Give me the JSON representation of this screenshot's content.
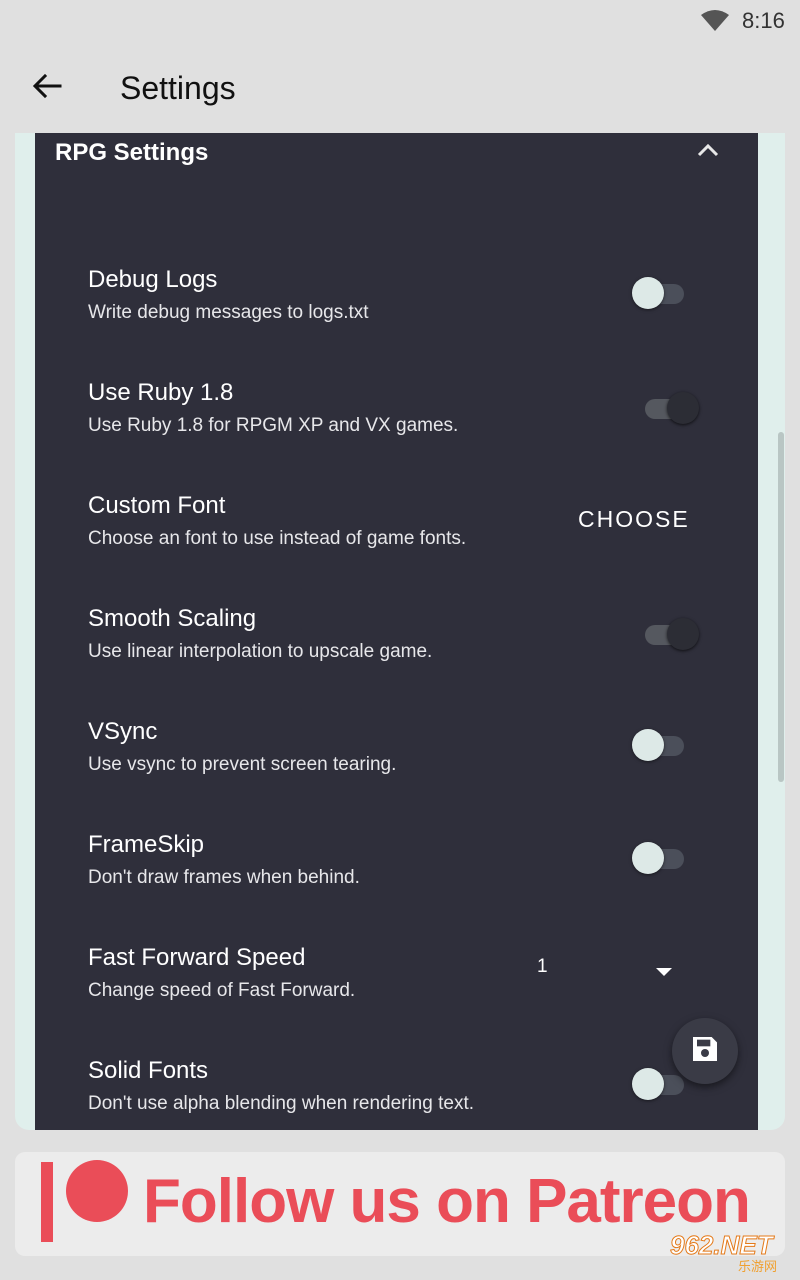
{
  "status_bar": {
    "time": "8:16",
    "wifi_icon": "wifi-icon"
  },
  "app_bar": {
    "title": "Settings",
    "back_icon": "arrow-left-icon"
  },
  "section": {
    "title": "RPG Settings",
    "collapse_icon": "chevron-up-icon"
  },
  "settings": {
    "debug_logs": {
      "title": "Debug Logs",
      "subtitle": "Write debug messages to logs.txt",
      "enabled": false
    },
    "use_ruby": {
      "title": "Use Ruby 1.8",
      "subtitle": "Use Ruby 1.8 for RPGM XP and VX games.",
      "enabled": true
    },
    "custom_font": {
      "title": "Custom Font",
      "subtitle": "Choose an font to use instead of game fonts.",
      "action_label": "CHOOSE"
    },
    "smooth_scaling": {
      "title": "Smooth Scaling",
      "subtitle": "Use linear interpolation to upscale game.",
      "enabled": true
    },
    "vsync": {
      "title": "VSync",
      "subtitle": "Use vsync to prevent screen tearing.",
      "enabled": false
    },
    "frameskip": {
      "title": "FrameSkip",
      "subtitle": "Don't draw frames when behind.",
      "enabled": false
    },
    "fast_forward": {
      "title": "Fast Forward Speed",
      "subtitle": "Change speed of Fast Forward.",
      "selected": "1"
    },
    "solid_fonts": {
      "title": "Solid Fonts",
      "subtitle": "Don't use alpha blending when rendering text.",
      "enabled": false
    }
  },
  "fab": {
    "icon": "save-icon"
  },
  "banner": {
    "text": "Follow us on Patreon"
  },
  "watermark": {
    "big": "962.NET",
    "small": "乐游网"
  },
  "colors": {
    "panel": "#2f2f3b",
    "accent": "#ea4d58",
    "outer": "#e0efec"
  }
}
